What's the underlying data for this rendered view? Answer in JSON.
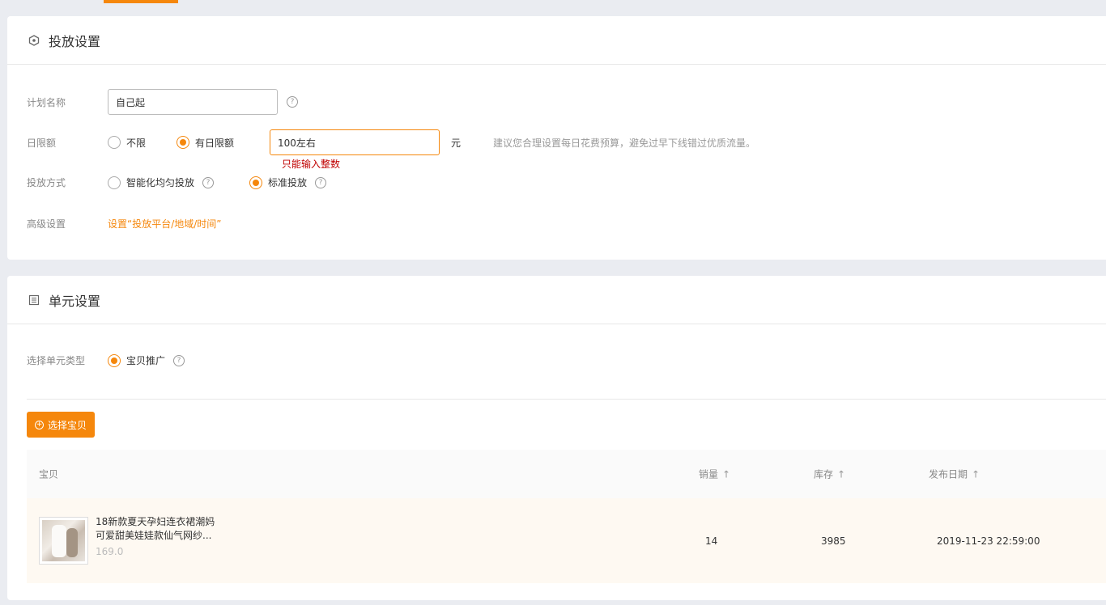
{
  "delivery": {
    "title": "投放设置",
    "plan_name_label": "计划名称",
    "plan_name_value": "自己起",
    "daily_limit_label": "日限额",
    "option_unlimited": "不限",
    "option_daily_limit": "有日限额",
    "daily_limit_value": "100左右",
    "unit": "元",
    "daily_limit_tip": "建议您合理设置每日花费预算，避免过早下线错过优质流量。",
    "daily_limit_error": "只能输入整数",
    "mode_label": "投放方式",
    "mode_smart": "智能化均匀投放",
    "mode_standard": "标准投放",
    "advanced_label": "高级设置",
    "advanced_link": "设置“投放平台/地域/时间”"
  },
  "unit": {
    "title": "单元设置",
    "type_label": "选择单元类型",
    "type_option": "宝贝推广",
    "select_button": "选择宝贝",
    "table": {
      "col_item": "宝贝",
      "col_sales": "销量",
      "col_stock": "库存",
      "col_date": "发布日期",
      "sort_symbol": "↑"
    },
    "rows": [
      {
        "title_line1": "18新款夏天孕妇连衣裙潮妈",
        "title_line2": "可爱甜美娃娃款仙气网纱...",
        "price": "169.0",
        "sales": "14",
        "stock": "3985",
        "date": "2019-11-23 22:59:00"
      }
    ]
  },
  "icons": {
    "delivery_icon": "hexagon-icon",
    "unit_icon": "list-icon",
    "help_glyph": "?",
    "plus_glyph": "+"
  },
  "colors": {
    "accent": "#f5870c",
    "error": "#c00000"
  }
}
